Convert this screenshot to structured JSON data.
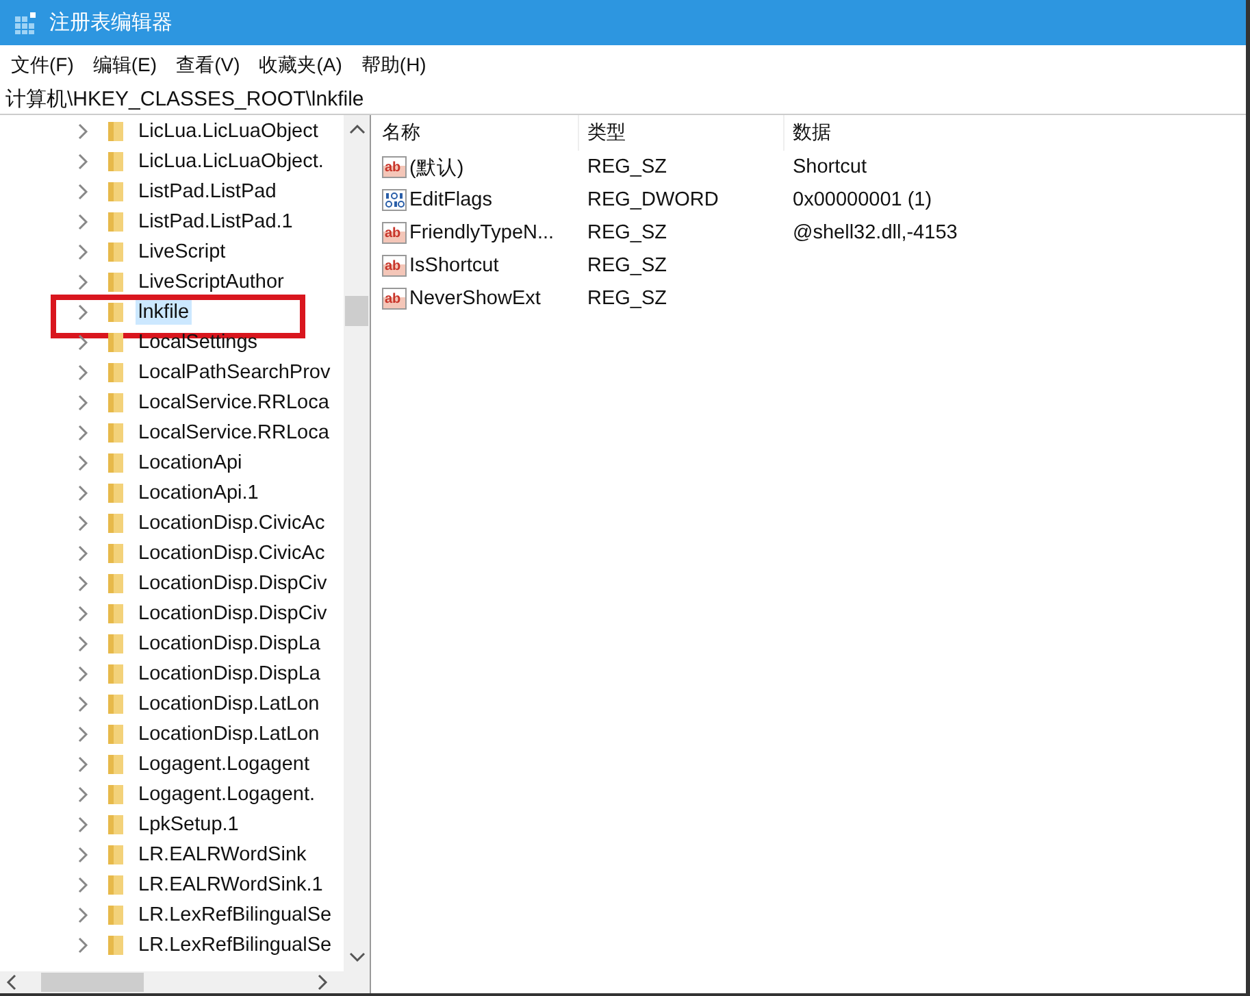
{
  "window": {
    "title": "注册表编辑器"
  },
  "menu": [
    "文件(F)",
    "编辑(E)",
    "查看(V)",
    "收藏夹(A)",
    "帮助(H)"
  ],
  "address": "计算机\\HKEY_CLASSES_ROOT\\lnkfile",
  "tree": {
    "items": [
      {
        "label": "LicLua.LicLuaObject",
        "selected": false,
        "highlighted": false
      },
      {
        "label": "LicLua.LicLuaObject.",
        "selected": false,
        "highlighted": false
      },
      {
        "label": "ListPad.ListPad",
        "selected": false,
        "highlighted": false
      },
      {
        "label": "ListPad.ListPad.1",
        "selected": false,
        "highlighted": false
      },
      {
        "label": "LiveScript",
        "selected": false,
        "highlighted": false
      },
      {
        "label": "LiveScriptAuthor",
        "selected": false,
        "highlighted": false
      },
      {
        "label": "lnkfile",
        "selected": true,
        "highlighted": true
      },
      {
        "label": "LocalSettings",
        "selected": false,
        "highlighted": false
      },
      {
        "label": "LocalPathSearchProv",
        "selected": false,
        "highlighted": false
      },
      {
        "label": "LocalService.RRLoca",
        "selected": false,
        "highlighted": false
      },
      {
        "label": "LocalService.RRLoca",
        "selected": false,
        "highlighted": false
      },
      {
        "label": "LocationApi",
        "selected": false,
        "highlighted": false
      },
      {
        "label": "LocationApi.1",
        "selected": false,
        "highlighted": false
      },
      {
        "label": "LocationDisp.CivicAc",
        "selected": false,
        "highlighted": false
      },
      {
        "label": "LocationDisp.CivicAc",
        "selected": false,
        "highlighted": false
      },
      {
        "label": "LocationDisp.DispCiv",
        "selected": false,
        "highlighted": false
      },
      {
        "label": "LocationDisp.DispCiv",
        "selected": false,
        "highlighted": false
      },
      {
        "label": "LocationDisp.DispLa",
        "selected": false,
        "highlighted": false
      },
      {
        "label": "LocationDisp.DispLa",
        "selected": false,
        "highlighted": false
      },
      {
        "label": "LocationDisp.LatLon",
        "selected": false,
        "highlighted": false
      },
      {
        "label": "LocationDisp.LatLon",
        "selected": false,
        "highlighted": false
      },
      {
        "label": "Logagent.Logagent",
        "selected": false,
        "highlighted": false
      },
      {
        "label": "Logagent.Logagent.",
        "selected": false,
        "highlighted": false
      },
      {
        "label": "LpkSetup.1",
        "selected": false,
        "highlighted": false
      },
      {
        "label": "LR.EALRWordSink",
        "selected": false,
        "highlighted": false
      },
      {
        "label": "LR.EALRWordSink.1",
        "selected": false,
        "highlighted": false
      },
      {
        "label": "LR.LexRefBilingualSe",
        "selected": false,
        "highlighted": false
      },
      {
        "label": "LR.LexRefBilingualSe",
        "selected": false,
        "highlighted": false
      }
    ]
  },
  "values": {
    "columns": [
      "名称",
      "类型",
      "数据"
    ],
    "rows": [
      {
        "kind": "string",
        "icon_label": "ab",
        "name": "(默认)",
        "type": "REG_SZ",
        "data": "Shortcut"
      },
      {
        "kind": "binary",
        "name": "EditFlags",
        "type": "REG_DWORD",
        "data": "0x00000001 (1)"
      },
      {
        "kind": "string",
        "icon_label": "ab",
        "name": "FriendlyTypeN...",
        "type": "REG_SZ",
        "data": "@shell32.dll,-4153"
      },
      {
        "kind": "string",
        "icon_label": "ab",
        "name": "IsShortcut",
        "type": "REG_SZ"
      },
      {
        "kind": "string",
        "icon_label": "ab",
        "name": "NeverShowExt",
        "type": "REG_SZ"
      }
    ]
  }
}
